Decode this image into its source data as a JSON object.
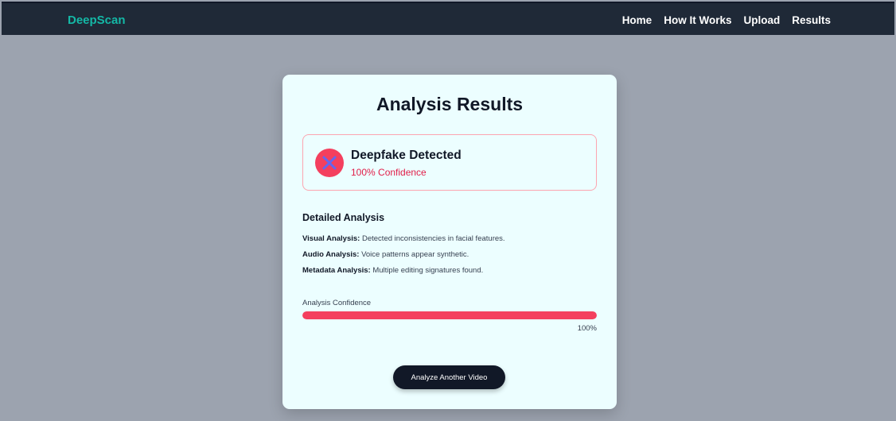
{
  "nav": {
    "brand": "DeepScan",
    "links": [
      "Home",
      "How It Works",
      "Upload",
      "Results"
    ]
  },
  "card": {
    "title": "Analysis Results",
    "result": {
      "icon": "x-icon",
      "title": "Deepfake Detected",
      "confidence_text": "100% Confidence"
    },
    "detailed": {
      "title": "Detailed Analysis",
      "items": [
        {
          "label": "Visual Analysis:",
          "text": "Detected inconsistencies in facial features."
        },
        {
          "label": "Audio Analysis:",
          "text": "Voice patterns appear synthetic."
        },
        {
          "label": "Metadata Analysis:",
          "text": "Multiple editing signatures found."
        }
      ]
    },
    "confidence": {
      "label": "Analysis Confidence",
      "value_text": "100%",
      "fraction": 1.0
    },
    "button_label": "Analyze Another Video"
  },
  "colors": {
    "brand": "#14b8a6",
    "nav_bg": "#1f2937",
    "page_bg": "#9ca3af",
    "card_bg": "#ecfeff",
    "alert": "#f43f5e",
    "button_bg": "#111827"
  }
}
